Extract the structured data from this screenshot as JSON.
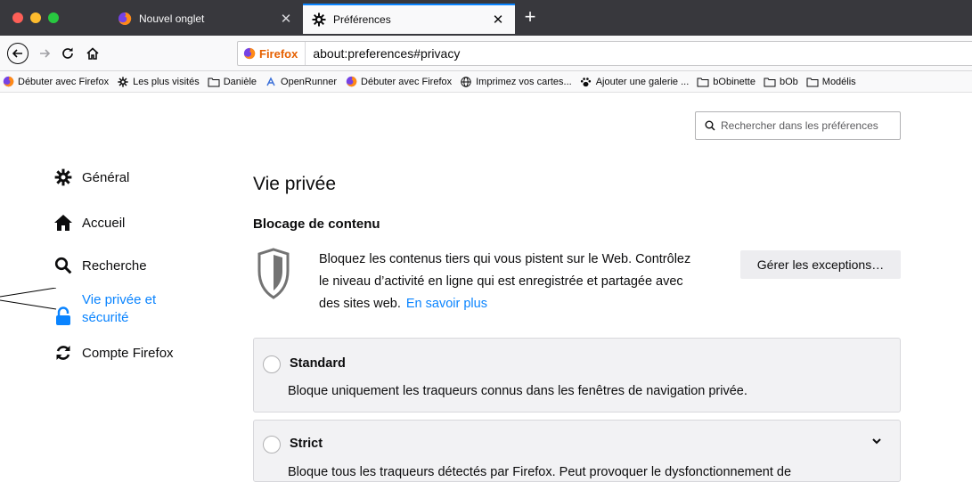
{
  "window": {
    "traffic_lights": [
      "#fe5f57",
      "#febc2e",
      "#28c840"
    ]
  },
  "tabs": [
    {
      "label": "Nouvel onglet",
      "icon": "firefox-icon",
      "active": false
    },
    {
      "label": "Préférences",
      "icon": "gear-icon",
      "active": true
    }
  ],
  "new_tab_label": "+",
  "navbar": {
    "identity_label": "Firefox",
    "url": "about:preferences#privacy"
  },
  "bookmarks": [
    {
      "label": "Débuter avec Firefox",
      "icon": "firefox-icon"
    },
    {
      "label": "Les plus visités",
      "icon": "gear-icon"
    },
    {
      "label": "Danièle",
      "icon": "folder-icon"
    },
    {
      "label": "OpenRunner",
      "icon": "openrunner-icon"
    },
    {
      "label": "Débuter avec Firefox",
      "icon": "firefox-icon"
    },
    {
      "label": "Imprimez vos cartes...",
      "icon": "globe-icon"
    },
    {
      "label": "Ajouter une galerie ...",
      "icon": "paw-icon"
    },
    {
      "label": "bObinette",
      "icon": "folder-icon"
    },
    {
      "label": "bOb",
      "icon": "folder-icon"
    },
    {
      "label": "Modélis",
      "icon": "folder-icon"
    }
  ],
  "search": {
    "placeholder": "Rechercher dans les préférences"
  },
  "sidebar": {
    "items": [
      {
        "label": "Général",
        "icon": "gear-icon"
      },
      {
        "label": "Accueil",
        "icon": "home-icon"
      },
      {
        "label": "Recherche",
        "icon": "search-icon"
      },
      {
        "label": "Vie privée et sécurité",
        "label_line1": "Vie privée et",
        "label_line2": "sécurité",
        "icon": "lock-icon",
        "active": true
      },
      {
        "label": "Compte Firefox",
        "icon": "sync-icon"
      }
    ]
  },
  "main": {
    "title": "Vie privée",
    "section_title": "Blocage de contenu",
    "description_lines": [
      "Bloquez les contenus tiers qui vous pistent sur le Web. Contrôlez",
      "le niveau d’activité en ligne qui est enregistrée et partagée avec",
      "des sites web."
    ],
    "learn_more": "En savoir plus",
    "exceptions_button": "Gérer les exceptions…",
    "options": [
      {
        "title": "Standard",
        "description": "Bloque uniquement les traqueurs connus dans les fenêtres de navigation privée."
      },
      {
        "title": "Strict",
        "description": "Bloque tous les traqueurs détectés par Firefox. Peut provoquer le dysfonctionnement de"
      }
    ]
  },
  "colors": {
    "accent": "#0a84ff",
    "tabbar": "#38383d",
    "firefox_orange": "#e66000"
  }
}
